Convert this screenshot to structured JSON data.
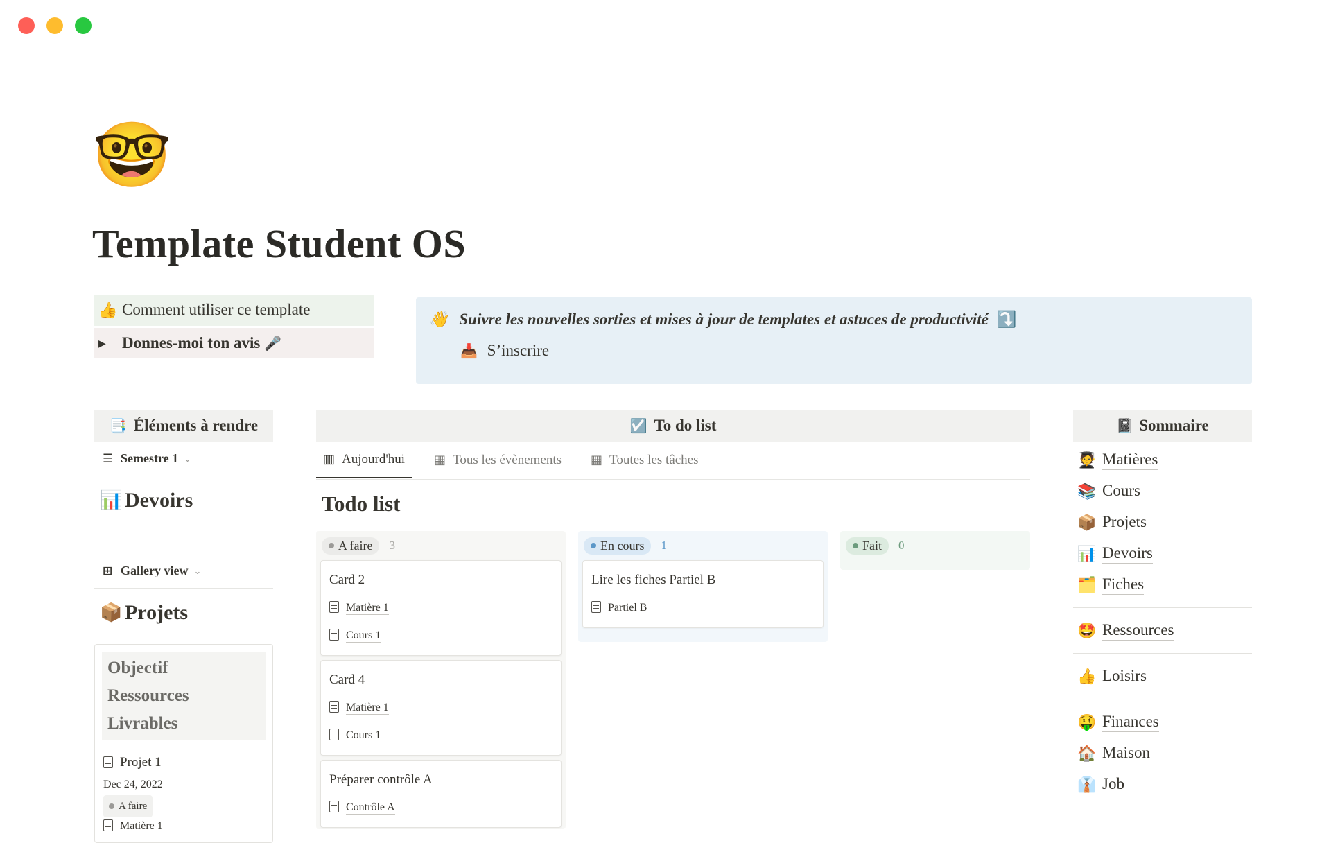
{
  "window": {
    "controls": [
      "close",
      "minimize",
      "maximize"
    ],
    "colors": {
      "close": "#fe5f57",
      "minimize": "#febc2e",
      "maximize": "#28c840"
    }
  },
  "page": {
    "icon": "🤓",
    "title": "Template Student OS"
  },
  "callout_left": {
    "row1": {
      "icon": "👍",
      "label": "Comment utiliser ce template"
    },
    "row2": {
      "toggle": "▶",
      "label": "Donnes-moi ton avis",
      "icon": "🎤"
    }
  },
  "callout_right": {
    "icon": "👋",
    "text": "Suivre les nouvelles sorties et mises à jour de templates et astuces de productivité",
    "arrow": "⤵️",
    "link_icon": "📥",
    "link_label": "S’inscrire"
  },
  "left": {
    "header": {
      "icon": "📑",
      "label": "Éléments à rendre"
    },
    "view1": {
      "icon": "☰",
      "label": "Semestre 1",
      "chevron": "⌄"
    },
    "devoirs": {
      "icon": "📊",
      "label": "Devoirs"
    },
    "view2": {
      "icon": "⊞",
      "label": "Gallery view",
      "chevron": "⌄"
    },
    "projets": {
      "icon": "📦",
      "label": "Projets"
    },
    "card": {
      "cover_lines": [
        "Objectif",
        "Ressources",
        "Livrables"
      ],
      "title": "Projet 1",
      "date": "Dec 24, 2022",
      "status": "A faire",
      "relation": "Matière 1"
    }
  },
  "center": {
    "header": {
      "icon": "☑️",
      "label": "To do list"
    },
    "tabs": [
      {
        "icon": "▥",
        "label": "Aujourd'hui"
      },
      {
        "icon": "▦",
        "label": "Tous les évènements"
      },
      {
        "icon": "▦",
        "label": "Toutes les tâches"
      }
    ],
    "title": "Todo list",
    "columns": [
      {
        "label": "A faire",
        "count": "3",
        "dot": "#9b9a97",
        "pill_bg": "#ebebe9",
        "col_bg": "#f7f7f5",
        "count_color": "#a5a4a0"
      },
      {
        "label": "En cours",
        "count": "1",
        "dot": "#5b97c8",
        "pill_bg": "#d9e8f5",
        "col_bg": "#f2f7fb",
        "count_color": "#5b97c8"
      },
      {
        "label": "Fait",
        "count": "0",
        "dot": "#6c9b7d",
        "pill_bg": "#dcebdf",
        "col_bg": "#f3f8f4",
        "count_color": "#6c9b7d"
      }
    ],
    "cards_todo": [
      {
        "title": "Card 2",
        "props": [
          "Matière 1",
          "Cours 1"
        ]
      },
      {
        "title": "Card 4",
        "props": [
          "Matière 1",
          "Cours 1"
        ]
      },
      {
        "title": "Préparer contrôle A",
        "props": [
          "Contrôle A"
        ]
      }
    ],
    "cards_doing": [
      {
        "title": "Lire les fiches Partiel B",
        "props": [
          "Partiel B"
        ]
      }
    ]
  },
  "right": {
    "header": {
      "icon": "📓",
      "label": "Sommaire"
    },
    "group1": [
      {
        "icon": "🧑‍🎓",
        "label": "Matières"
      },
      {
        "icon": "📚",
        "label": "Cours"
      },
      {
        "icon": "📦",
        "label": "Projets"
      },
      {
        "icon": "📊",
        "label": "Devoirs"
      },
      {
        "icon": "🗂️",
        "label": "Fiches"
      }
    ],
    "group2": [
      {
        "icon": "🤩",
        "label": "Ressources"
      }
    ],
    "group3": [
      {
        "icon": "👍",
        "label": "Loisirs"
      }
    ],
    "group4": [
      {
        "icon": "🤑",
        "label": "Finances"
      },
      {
        "icon": "🏠",
        "label": "Maison"
      },
      {
        "icon": "👔",
        "label": "Job"
      }
    ]
  }
}
